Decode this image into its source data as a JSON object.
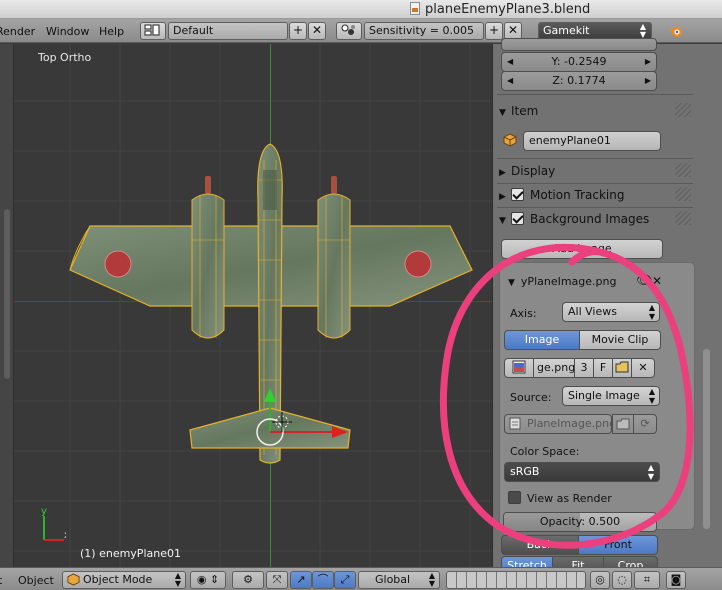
{
  "window": {
    "document_title": "planeEnemyPlane3.blend"
  },
  "topbar": {
    "menus": [
      "Render",
      "Window",
      "Help"
    ],
    "layout_value": "Default",
    "sensitivity_label": "Sensitivity = 0.005",
    "engine_value": "Gamekit"
  },
  "viewport": {
    "view_label": "Top Ortho",
    "object_label": "(1) enemyPlane01",
    "axis_y": "y",
    "axis_x": "x"
  },
  "transform": {
    "y_label": "Y: -0.2549",
    "z_label": "Z: 0.1774"
  },
  "panels": {
    "item": {
      "label": "Item",
      "object_name": "enemyPlane01"
    },
    "display": {
      "label": "Display"
    },
    "motion_tracking": {
      "label": "Motion Tracking",
      "checked": true
    },
    "background_images": {
      "label": "Background Images",
      "checked": true,
      "add_image_label": "Add Image",
      "image_entry": {
        "name": "yPlaneImage.png",
        "axis_label": "Axis:",
        "axis_value": "All Views",
        "tab_image": "Image",
        "tab_movie_clip": "Movie Clip",
        "file_name": "ge.png",
        "users_count": "3",
        "fake_user": "F",
        "source_label": "Source:",
        "source_value": "Single Image",
        "filepath": "PlaneImage.png",
        "color_space_label": "Color Space:",
        "color_space_value": "sRGB",
        "view_as_render_label": "View as Render"
      },
      "opacity_label": "Opacity:",
      "opacity_value": "0.500",
      "back_label": "Back",
      "front_label": "Front",
      "stretch_label": "Stretch",
      "fit_label": "Fit",
      "crop_label": "Crop"
    }
  },
  "bottombar": {
    "menus": [
      "t",
      "Object"
    ],
    "mode_value": "Object Mode",
    "orientation_value": "Global"
  },
  "colors": {
    "viewport_bg": "#393939",
    "panel_bg": "#727272",
    "selected_blue": "#5a84cc",
    "annotation_pink": "#ec3f7e",
    "axis_green": "#3f8a3f",
    "axis_red": "#8a3030"
  }
}
